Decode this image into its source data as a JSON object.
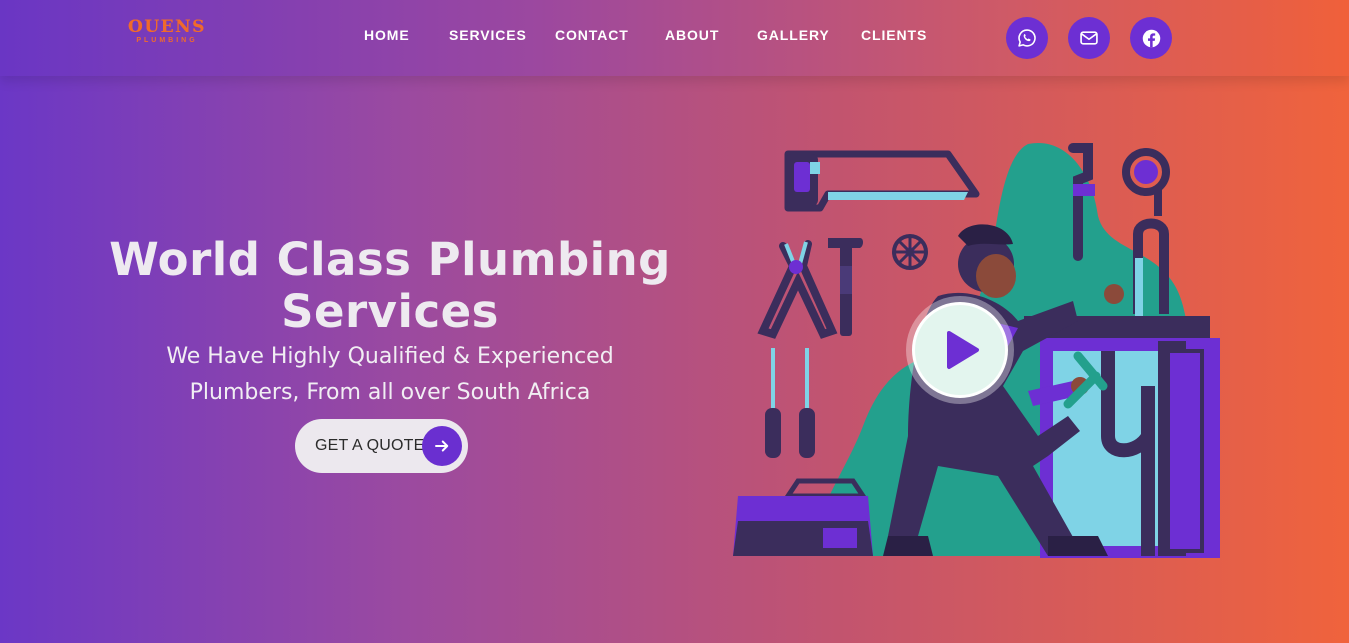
{
  "brand": {
    "logo_top": "OUENS",
    "logo_bottom": "PLUMBING"
  },
  "nav": {
    "items": [
      "HOME",
      "SERVICES",
      "CONTACT",
      "ABOUT",
      "GALLERY",
      "CLIENTS"
    ]
  },
  "social": [
    {
      "name": "whatsapp-icon"
    },
    {
      "name": "email-icon"
    },
    {
      "name": "facebook-icon"
    }
  ],
  "hero": {
    "title_line1": "World Class Plumbing",
    "title_line2": "Services",
    "subtitle_line1": "We Have Highly Qualified & Experienced",
    "subtitle_line2": "Plumbers, From all over South Africa",
    "cta_label": "GET A QUOTE",
    "cta_icon": "arrow-right-icon",
    "play_icon": "play-icon"
  },
  "colors": {
    "accent_purple": "#6d2fd3",
    "accent_orange": "#f06a2c",
    "teal": "#23a08d",
    "dark_purple": "#3b2d5c"
  }
}
